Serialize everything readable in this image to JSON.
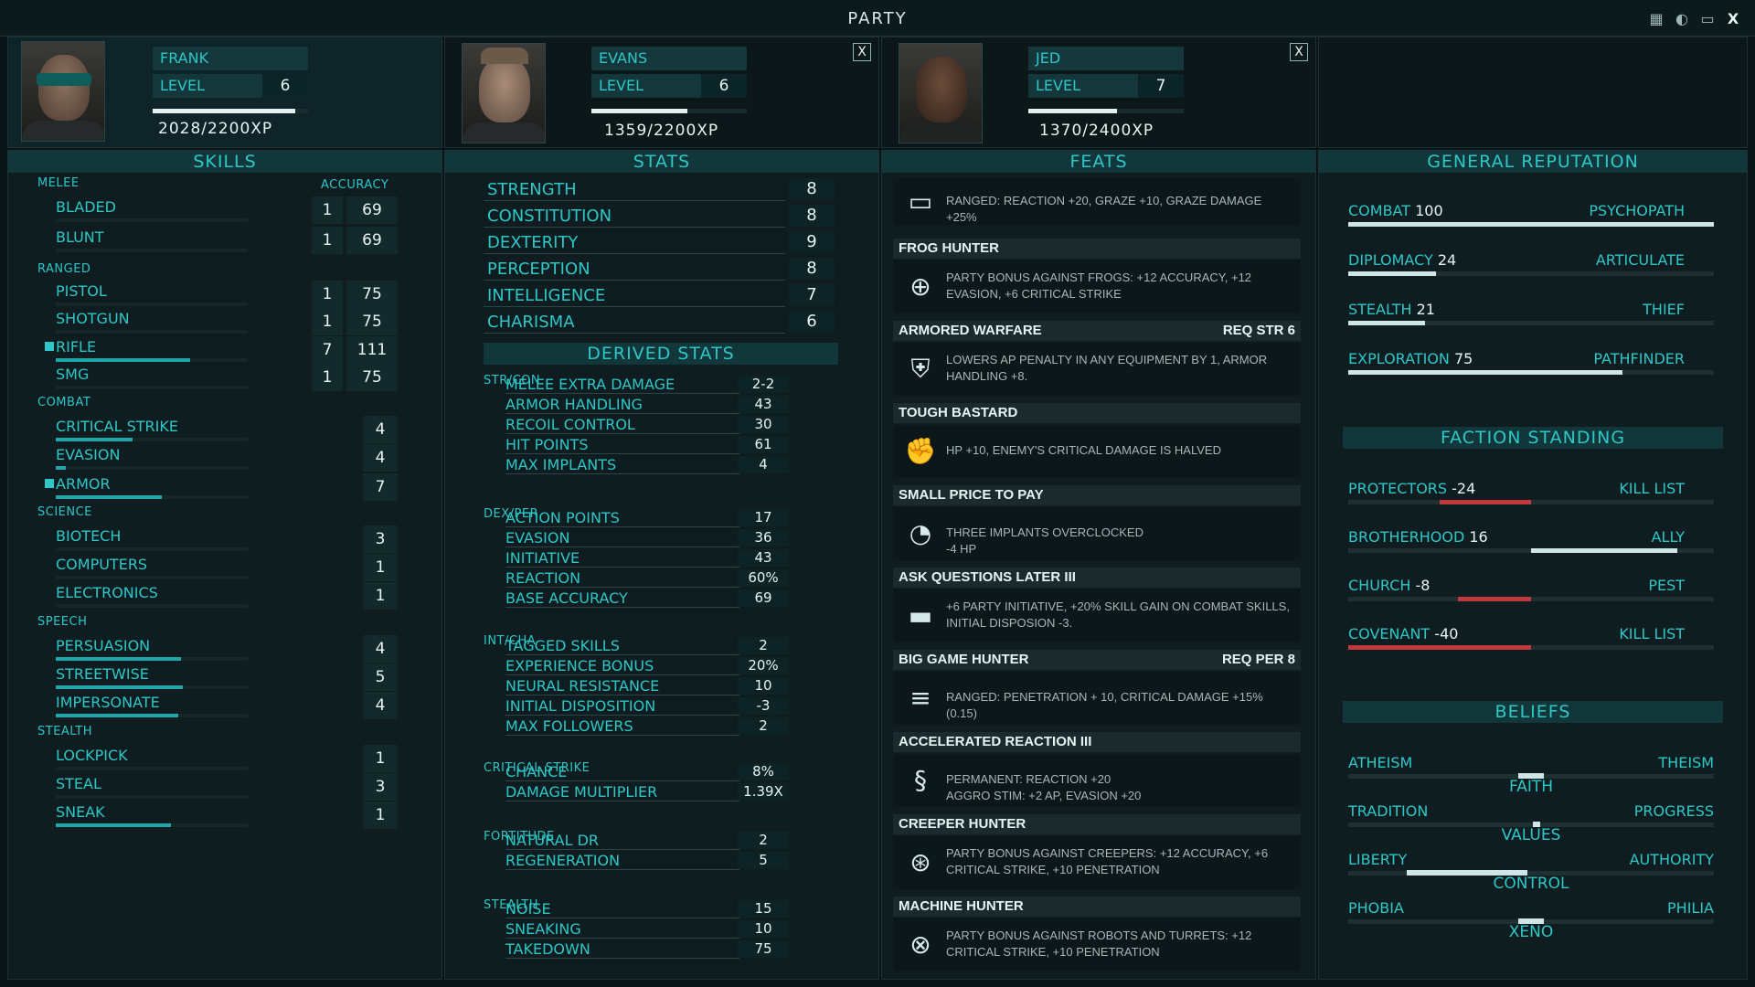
{
  "window": {
    "title": "PARTY"
  },
  "party": [
    {
      "name": "FRANK",
      "level_label": "LEVEL",
      "level": "6",
      "xp": "2028/2200XP",
      "xp_pct": 0.92
    },
    {
      "name": "EVANS",
      "level_label": "LEVEL",
      "level": "6",
      "xp": "1359/2200XP",
      "xp_pct": 0.62
    },
    {
      "name": "JED",
      "level_label": "LEVEL",
      "level": "7",
      "xp": "1370/2400XP",
      "xp_pct": 0.57
    }
  ],
  "close_label": "X",
  "skills": {
    "header": "SKILLS",
    "acc_header": "ACCURACY",
    "cats": [
      "MELEE",
      "RANGED",
      "COMBAT",
      "SCIENCE",
      "SPEECH",
      "STEALTH"
    ],
    "items": [
      {
        "name": "BLADED",
        "v": "1",
        "acc": "69",
        "fill": 0
      },
      {
        "name": "BLUNT",
        "v": "1",
        "acc": "69",
        "fill": 0
      },
      {
        "name": "PISTOL",
        "v": "1",
        "acc": "75",
        "fill": 0
      },
      {
        "name": "SHOTGUN",
        "v": "1",
        "acc": "75",
        "fill": 0
      },
      {
        "name": "RIFLE",
        "v": "7",
        "acc": "111",
        "fill": 0.7
      },
      {
        "name": "SMG",
        "v": "1",
        "acc": "75",
        "fill": 0
      },
      {
        "name": "CRITICAL STRIKE",
        "v": "4",
        "fill": 0.4
      },
      {
        "name": "EVASION",
        "v": "4",
        "fill": 0.05
      },
      {
        "name": "ARMOR",
        "v": "7",
        "fill": 0.55
      },
      {
        "name": "BIOTECH",
        "v": "3",
        "fill": 0
      },
      {
        "name": "COMPUTERS",
        "v": "1",
        "fill": 0
      },
      {
        "name": "ELECTRONICS",
        "v": "1",
        "fill": 0
      },
      {
        "name": "PERSUASION",
        "v": "4",
        "fill": 0.65
      },
      {
        "name": "STREETWISE",
        "v": "5",
        "fill": 0.66
      },
      {
        "name": "IMPERSONATE",
        "v": "4",
        "fill": 0.64
      },
      {
        "name": "LOCKPICK",
        "v": "1",
        "fill": 0
      },
      {
        "name": "STEAL",
        "v": "3",
        "fill": 0
      },
      {
        "name": "SNEAK",
        "v": "1",
        "fill": 0.6
      }
    ]
  },
  "stats": {
    "header": "STATS",
    "items": [
      {
        "name": "STRENGTH",
        "v": "8"
      },
      {
        "name": "CONSTITUTION",
        "v": "8"
      },
      {
        "name": "DEXTERITY",
        "v": "9"
      },
      {
        "name": "PERCEPTION",
        "v": "8"
      },
      {
        "name": "INTELLIGENCE",
        "v": "7"
      },
      {
        "name": "CHARISMA",
        "v": "6"
      }
    ],
    "derived_header": "DERIVED STATS",
    "groups": [
      {
        "label": "STR/CON",
        "rows": [
          [
            "MELEE EXTRA DAMAGE",
            "2-2"
          ],
          [
            "ARMOR HANDLING",
            "43"
          ],
          [
            "RECOIL CONTROL",
            "30"
          ],
          [
            "HIT POINTS",
            "61"
          ],
          [
            "MAX IMPLANTS",
            "4"
          ]
        ]
      },
      {
        "label": "DEX/PER",
        "rows": [
          [
            "ACTION POINTS",
            "17"
          ],
          [
            "EVASION",
            "36"
          ],
          [
            "INITIATIVE",
            "43"
          ],
          [
            "REACTION",
            "60%"
          ],
          [
            "BASE ACCURACY",
            "69"
          ]
        ]
      },
      {
        "label": "INT/CHA",
        "rows": [
          [
            "TAGGED SKILLS",
            "2"
          ],
          [
            "EXPERIENCE BONUS",
            "20%"
          ],
          [
            "NEURAL RESISTANCE",
            "10"
          ],
          [
            "INITIAL DISPOSITION",
            "-3"
          ],
          [
            "MAX FOLLOWERS",
            "2"
          ]
        ]
      },
      {
        "label": "CRITICAL STRIKE",
        "rows": [
          [
            "CHANCE",
            "8%"
          ],
          [
            "DAMAGE MULTIPLIER",
            "1.39x"
          ]
        ]
      },
      {
        "label": "FORTITUDE",
        "rows": [
          [
            "NATURAL DR",
            "2"
          ],
          [
            "REGENERATION",
            "5"
          ]
        ]
      },
      {
        "label": "STEALTH",
        "rows": [
          [
            "NOISE",
            "15"
          ],
          [
            "SNEAKING",
            "10"
          ],
          [
            "TAKEDOWN",
            "75"
          ]
        ]
      }
    ]
  },
  "feats": {
    "header": "FEATS",
    "first_text": "RANGED: REACTION +20, GRAZE +10, GRAZE DAMAGE +25%",
    "items": [
      {
        "name": "FROG HUNTER",
        "req": "",
        "text": "PARTY BONUS AGAINST FROGS: +12 ACCURACY, +12 EVASION, +6 CRITICAL STRIKE",
        "icon": "crosshair-icon",
        "glyph": "⊕"
      },
      {
        "name": "ARMORED WARFARE",
        "req": "REQ STR 6",
        "text": "LOWERS AP PENALTY IN ANY EQUIPMENT BY 1, ARMOR HANDLING +8.",
        "icon": "armor-icon",
        "glyph": "⛨"
      },
      {
        "name": "TOUGH BASTARD",
        "req": "",
        "text": "HP +10, ENEMY'S CRITICAL DAMAGE IS HALVED",
        "icon": "fist-icon",
        "glyph": "✊"
      },
      {
        "name": "SMALL PRICE TO PAY",
        "req": "",
        "text": "THREE IMPLANTS OVERCLOCKED\n-4 HP",
        "icon": "gauge-icon",
        "glyph": "◔"
      },
      {
        "name": "ASK QUESTIONS LATER III",
        "req": "",
        "text": "+6 PARTY INITIATIVE, +20% SKILL GAIN ON COMBAT SKILLS, INITIAL DISPOSION -3.",
        "icon": "gun-icon",
        "glyph": "▬"
      },
      {
        "name": "BIG GAME HUNTER",
        "req": "REQ PER 8",
        "text": "RANGED: PENETRATION + 10, CRITICAL DAMAGE +15% (0.15)",
        "icon": "rifle-icon",
        "glyph": "≡"
      },
      {
        "name": "ACCELERATED REACTION III",
        "req": "",
        "text": "PERMANENT: REACTION +20\nAGGRO STIM: +2 AP, EVASION +20",
        "icon": "dna-icon",
        "glyph": "§"
      },
      {
        "name": "CREEPER HUNTER",
        "req": "",
        "text": "PARTY BONUS AGAINST CREEPERS: +12 ACCURACY, +6 CRITICAL STRIKE, +10 PENETRATION",
        "icon": "crosshair-icon",
        "glyph": "⊛"
      },
      {
        "name": "MACHINE HUNTER",
        "req": "",
        "text": "PARTY BONUS AGAINST ROBOTS AND TURRETS: +12 CRITICAL STRIKE, +10 PENETRATION",
        "icon": "crosshair-icon",
        "glyph": "⊗"
      }
    ]
  },
  "reputation": {
    "header": "GENERAL REPUTATION",
    "items": [
      {
        "name": "COMBAT",
        "v": "100",
        "title": "PSYCHOPATH",
        "fill": 1.0
      },
      {
        "name": "DIPLOMACY",
        "v": "24",
        "title": "ARTICULATE",
        "fill": 0.24
      },
      {
        "name": "STEALTH",
        "v": "21",
        "title": "THIEF",
        "fill": 0.21
      },
      {
        "name": "EXPLORATION",
        "v": "75",
        "title": "PATHFINDER",
        "fill": 0.75
      }
    ]
  },
  "faction": {
    "header": "FACTION STANDING",
    "items": [
      {
        "name": "PROTECTORS",
        "v": "-24",
        "title": "KILL LIST",
        "value": -0.5,
        "color": "#c0393b"
      },
      {
        "name": "BROTHERHOOD",
        "v": "16",
        "title": "ALLY",
        "value": 0.8,
        "color": "#cfe6e8"
      },
      {
        "name": "CHURCH",
        "v": "-8",
        "title": "PEST",
        "value": -0.4,
        "color": "#c0393b"
      },
      {
        "name": "COVENANT",
        "v": "-40",
        "title": "KILL LIST",
        "value": -1.0,
        "color": "#c0393b"
      }
    ]
  },
  "beliefs": {
    "header": "BELIEFS",
    "items": [
      {
        "left": "ATHEISM",
        "right": "THEISM",
        "center": "FAITH",
        "value": 0.0,
        "span": 0.14
      },
      {
        "left": "TRADITION",
        "right": "PROGRESS",
        "center": "VALUES",
        "value": 0.03,
        "span": 0.04
      },
      {
        "left": "LIBERTY",
        "right": "AUTHORITY",
        "center": "CONTROL",
        "value": -0.35,
        "span": 0.66
      },
      {
        "left": "PHOBIA",
        "right": "PHILIA",
        "center": "XENO",
        "value": 0.0,
        "span": 0.14
      }
    ]
  }
}
